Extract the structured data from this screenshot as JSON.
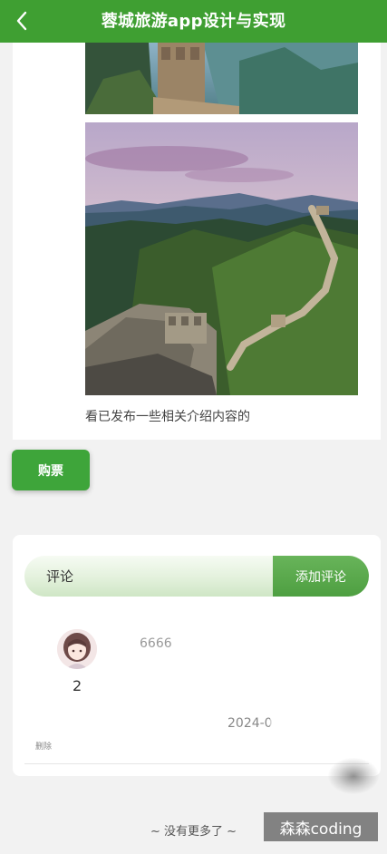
{
  "header": {
    "title": "蓉城旅游app设计与实现",
    "back_icon": "chevron-left-icon"
  },
  "content": {
    "images": [
      "great-wall-photo-top",
      "great-wall-photo-main"
    ],
    "description": "看已发布一些相关介绍内容的"
  },
  "actions": {
    "buy_label": "购票"
  },
  "comments": {
    "input_placeholder": "评论",
    "add_label": "添加评论",
    "items": [
      {
        "user": "2",
        "text": "6666",
        "date": "2024-0",
        "delete_label": "删除",
        "avatar_icon": "user-avatar-icon"
      }
    ]
  },
  "footer": {
    "no_more": "~ 没有更多了 ~",
    "watermark": "森森coding"
  },
  "colors": {
    "primary": "#3f9f32",
    "button": "#3ea53a",
    "background": "#f2f2f2"
  }
}
